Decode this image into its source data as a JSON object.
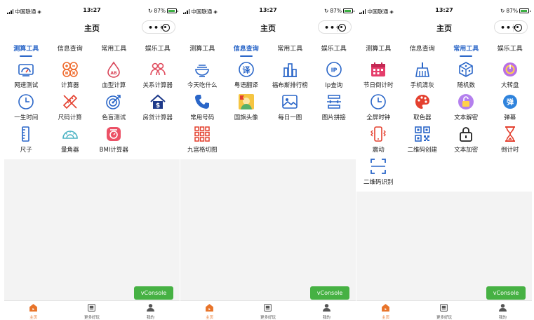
{
  "status": {
    "carrier": "中国联通",
    "time": "13:27",
    "battery": "87%"
  },
  "nav": {
    "title": "主页"
  },
  "tabs": [
    "测算工具",
    "信息查询",
    "常用工具",
    "娱乐工具"
  ],
  "vconsole": "vConsole",
  "tabbar": [
    "主页",
    "更多好玩",
    "我的"
  ],
  "colors": {
    "accent": "#2a66c8",
    "vconsole": "#46b143",
    "tabbar_active": "#e8742a"
  },
  "panels": [
    {
      "active_tab": 0,
      "items": [
        {
          "label": "网速测试",
          "icon": "speedometer-icon"
        },
        {
          "label": "计算器",
          "icon": "calculator-icon"
        },
        {
          "label": "血型计算",
          "icon": "blood-drop-icon"
        },
        {
          "label": "关系计算器",
          "icon": "people-icon"
        },
        {
          "label": "一生时间",
          "icon": "clock-icon"
        },
        {
          "label": "尺码计算",
          "icon": "pencil-ruler-icon"
        },
        {
          "label": "色盲测试",
          "icon": "target-icon"
        },
        {
          "label": "房贷计算器",
          "icon": "house-dollar-icon"
        },
        {
          "label": "尺子",
          "icon": "ruler-icon"
        },
        {
          "label": "量角器",
          "icon": "protractor-icon"
        },
        {
          "label": "BMI计算器",
          "icon": "scale-icon"
        }
      ]
    },
    {
      "active_tab": 1,
      "items": [
        {
          "label": "今天吃什么",
          "icon": "bowl-icon"
        },
        {
          "label": "粤语翻译",
          "icon": "translate-icon"
        },
        {
          "label": "福布斯排行榜",
          "icon": "buildings-icon"
        },
        {
          "label": "Ip查询",
          "icon": "ip-pin-icon"
        },
        {
          "label": "常用号码",
          "icon": "phone-icon"
        },
        {
          "label": "国旗头像",
          "icon": "flag-avatar-icon"
        },
        {
          "label": "每日一图",
          "icon": "picture-icon"
        },
        {
          "label": "图片拼接",
          "icon": "collage-icon"
        },
        {
          "label": "九宫格切图",
          "icon": "nine-grid-icon"
        }
      ]
    },
    {
      "active_tab": 2,
      "items": [
        {
          "label": "节日倒计时",
          "icon": "calendar-icon"
        },
        {
          "label": "手机清灰",
          "icon": "broom-icon"
        },
        {
          "label": "随机数",
          "icon": "dice-icon"
        },
        {
          "label": "大转盘",
          "icon": "wheel-icon"
        },
        {
          "label": "全屏时钟",
          "icon": "clock-icon"
        },
        {
          "label": "取色器",
          "icon": "palette-icon"
        },
        {
          "label": "文本解密",
          "icon": "unlock-icon"
        },
        {
          "label": "弹幕",
          "icon": "danmaku-icon"
        },
        {
          "label": "震动",
          "icon": "vibrate-icon"
        },
        {
          "label": "二维码创建",
          "icon": "qrcode-icon"
        },
        {
          "label": "文本加密",
          "icon": "lock-icon"
        },
        {
          "label": "倒计时",
          "icon": "hourglass-icon"
        },
        {
          "label": "二维码识别",
          "icon": "scan-icon"
        }
      ]
    }
  ]
}
